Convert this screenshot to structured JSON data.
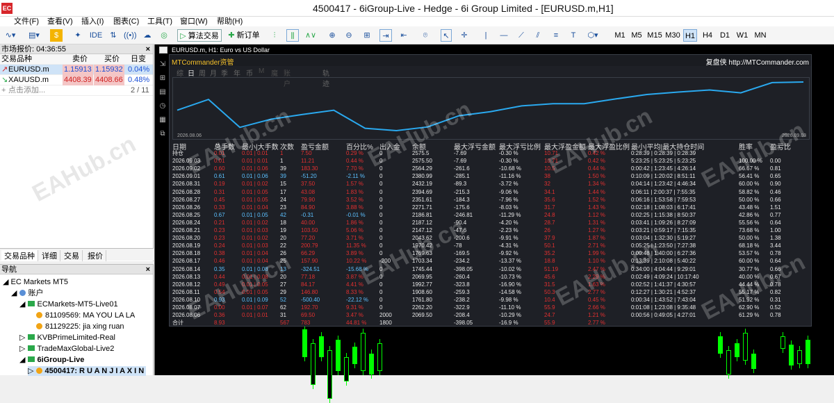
{
  "app": {
    "icon_label": "EC",
    "window_title": "4500417 - 6iGroup-Live - Hedge - 6i Group Limited - [EURUSD.m,H1]"
  },
  "menu": [
    "文件(F)",
    "查看(V)",
    "插入(I)",
    "图表(C)",
    "工具(T)",
    "窗口(W)",
    "帮助(H)"
  ],
  "toolbar": {
    "algo_trading": "算法交易",
    "new_order": "新订单",
    "ide": "IDE",
    "timeframes": [
      "M1",
      "M5",
      "M15",
      "M30",
      "H1",
      "H4",
      "D1",
      "W1",
      "MN"
    ],
    "active_tf": "H1"
  },
  "market_watch": {
    "title": "市场报价: 04:36:55",
    "columns": [
      "交易品种",
      "卖价",
      "买价",
      "日变化"
    ],
    "rows": [
      {
        "symbol": "EURUSD.m",
        "bid": "1.15913",
        "ask": "1.15932",
        "change": "0.04%"
      },
      {
        "symbol": "XAUUSD.m",
        "bid": "4408.39",
        "ask": "4408.66",
        "change": "0.48%"
      }
    ],
    "add_label": "点击添加...",
    "count": "2 / 11",
    "tabs": [
      "交易品种",
      "详细",
      "交易",
      "报价"
    ]
  },
  "navigator": {
    "title": "导航",
    "root": "EC Markets MT5",
    "accounts_label": "账户",
    "items": [
      {
        "label": "ECMarkets-MT5-Live01",
        "type": "server"
      },
      {
        "label": "81109569: MA YOU LA LA",
        "type": "account"
      },
      {
        "label": "81129225: jia xing ruan",
        "type": "account"
      },
      {
        "label": "KVBPrimeLimited-Real",
        "type": "server"
      },
      {
        "label": "TradeMaxGlobal-Live2",
        "type": "server"
      },
      {
        "label": "6iGroup-Live",
        "type": "server"
      },
      {
        "label": "4500417: R U A N J I A X I N G",
        "type": "account"
      }
    ]
  },
  "chart": {
    "title": "EURUSD.m, H1: Euro vs US Dollar",
    "watermark": "EAHub.cn",
    "colors": {
      "up": "#00ff00",
      "down": "#00ff00",
      "background": "#000000"
    }
  },
  "mtc": {
    "brand": "MTCommander资管",
    "link": "复盘侠 http://MTCommander.com",
    "period_tabs": [
      "综",
      "日",
      "周",
      "月",
      "季",
      "年",
      "币",
      "M",
      "魔",
      "账户",
      "轨迹"
    ],
    "active_tab": "日",
    "graph_start": "2026.08.06",
    "graph_end": "2026.09.03",
    "headers": [
      "日期",
      "总手数",
      "最小|大手数",
      "次数",
      "盈亏金额",
      "百分比%",
      "出入金",
      "余额",
      "最大浮亏金额",
      "最大浮亏比例",
      "最大浮盈金额",
      "最大浮盈比例",
      "最小|平均|最大持仓时间",
      "胜率",
      "盈亏比"
    ],
    "rows": [
      [
        "持仓",
        "0.01",
        "0.01 | 0.01",
        "1",
        "7.50",
        "0.29 %",
        "0",
        "2575.5",
        "-7.69",
        "-0.30 %",
        "10.71",
        "0.42 %",
        "0:28:39 | 0:28:39 | 0:28:39",
        "",
        ""
      ],
      [
        "2026.09.03",
        "0.01",
        "0.01 | 0.01",
        "1",
        "11.21",
        "0.44 %",
        "0",
        "2575.50",
        "-7.69",
        "-0.30 %",
        "10.71",
        "0.42 %",
        "5:23:25 | 5:23:25 | 5:23:25",
        "100.00 %",
        "0.00"
      ],
      [
        "2026.09.02",
        "0.60",
        "0.01 | 0.06",
        "39",
        "183.30",
        "7.70 %",
        "0",
        "2564.29",
        "-261.6",
        "-10.68 %",
        "10.5",
        "0.44 %",
        "0:00:42 | 1:23:45 | 4:26:14",
        "66.67 %",
        "0.81"
      ],
      [
        "2026.09.01",
        "0.61",
        "0.01 | 0.06",
        "39",
        "-51.20",
        "-2.11 %",
        "0",
        "2380.99",
        "-285.1",
        "-11.16 %",
        "38",
        "1.50 %",
        "0:10:09 | 1:20:02 | 8:51:11",
        "56.41 %",
        "0.65"
      ],
      [
        "2026.08.31",
        "0.19",
        "0.01 | 0.02",
        "15",
        "37.50",
        "1.57 %",
        "0",
        "2432.19",
        "-89.3",
        "-3.72 %",
        "32",
        "1.34 %",
        "0:04:14 | 1:23:42 | 4:46:34",
        "60.00 %",
        "0.90"
      ],
      [
        "2026.08.28",
        "0.31",
        "0.01 | 0.05",
        "17",
        "43.08",
        "1.83 %",
        "0",
        "2394.69",
        "-215.3",
        "-9.06 %",
        "34.1",
        "1.44 %",
        "0:06:11 | 2:00:37 | 7:55:35",
        "58.82 %",
        "0.46"
      ],
      [
        "2026.08.27",
        "0.45",
        "0.01 | 0.05",
        "24",
        "79.90",
        "3.52 %",
        "0",
        "2351.61",
        "-184.3",
        "-7.96 %",
        "35.6",
        "1.52 %",
        "0:06:16 | 1:53:58 | 7:59:53",
        "50.00 %",
        "0.66"
      ],
      [
        "2026.08.26",
        "0.33",
        "0.01 | 0.04",
        "23",
        "84.90",
        "3.88 %",
        "0",
        "2271.71",
        "-175.6",
        "-8.03 %",
        "31.7",
        "1.43 %",
        "0:02:18 | 1:08:03 | 6:17:41",
        "43.48 %",
        "1.51"
      ],
      [
        "2026.08.25",
        "0.67",
        "0.01 | 0.05",
        "42",
        "-0.31",
        "-0.01 %",
        "0",
        "2186.81",
        "-246.81",
        "-11.29 %",
        "24.8",
        "1.12 %",
        "0:02:25 | 1:15:38 | 8:50:37",
        "42.86 %",
        "0.77"
      ],
      [
        "2026.08.24",
        "0.21",
        "0.01 | 0.02",
        "18",
        "40.00",
        "1.86 %",
        "0",
        "2187.12",
        "-90.4",
        "-4.20 %",
        "28.7",
        "1.31 %",
        "0:03:41 | 1:09:26 | 8:27:09",
        "55.56 %",
        "0.64"
      ],
      [
        "2026.08.21",
        "0.23",
        "0.01 | 0.03",
        "19",
        "103.50",
        "5.06 %",
        "0",
        "2147.12",
        "-47.6",
        "-2.23 %",
        "26",
        "1.27 %",
        "0:03:21 | 0:59:17 | 7:15:35",
        "73.68 %",
        "1.00"
      ],
      [
        "2026.08.20",
        "0.23",
        "0.01 | 0.02",
        "20",
        "77.20",
        "3.71 %",
        "0",
        "2043.62",
        "-200.6",
        "-9.91 %",
        "37.9",
        "1.87 %",
        "0:03:04 | 1:32:30 | 5:19:27",
        "50.00 %",
        "1.38"
      ],
      [
        "2026.08.19",
        "0.24",
        "0.01 | 0.03",
        "22",
        "200.79",
        "11.35 %",
        "0",
        "1970.42",
        "-78",
        "-4.31 %",
        "50.1",
        "2.71 %",
        "0:05:25 | 1:23:50 | 7:27:38",
        "68.18 %",
        "3.44"
      ],
      [
        "2026.08.18",
        "0.38",
        "0.01 | 0.04",
        "26",
        "66.29",
        "3.89 %",
        "0",
        "1769.63",
        "-169.5",
        "-9.92 %",
        "35.2",
        "1.99 %",
        "0:00:48 | 1:40:00 | 6:27:36",
        "53.57 %",
        "0.78"
      ],
      [
        "2026.08.17",
        "0.46",
        "0.01 | 0.04",
        "25",
        "157.90",
        "10.22 %",
        "-200",
        "1703.34",
        "-234.2",
        "-13.37 %",
        "18.8",
        "1.10 %",
        "0:13:39 | 2:10:08 | 5:40:22",
        "60.00 %",
        "0.64"
      ],
      [
        "2026.08.14",
        "0.35",
        "0.01 | 0.08",
        "13",
        "-324.51",
        "-15.68 %",
        "0",
        "1745.44",
        "-398.05",
        "-10.02 %",
        "51.19",
        "2.47 %",
        "0:34:00 | 4:04:44 | 9:29:01",
        "30.77 %",
        "0.66"
      ],
      [
        "2026.08.13",
        "0.44",
        "0.01 | 0.08",
        "20",
        "77.18",
        "3.87 %",
        "0",
        "2069.95",
        "-260.4",
        "-10.73 %",
        "45.6",
        "2.29 %",
        "0:02:49 | 4:09:24 | 10:17:40",
        "40.00 %",
        "0.67"
      ],
      [
        "2026.08.12",
        "0.49",
        "0.01 | 0.05",
        "27",
        "84.17",
        "4.41 %",
        "0",
        "1992.77",
        "-323.8",
        "-16.90 %",
        "31.5",
        "1.63 %",
        "0:02:52 | 1:41:37 | 4:30:57",
        "44.44 %",
        "0.78"
      ],
      [
        "2026.08.11",
        "0.54",
        "0.01 | 0.05",
        "29",
        "146.80",
        "8.33 %",
        "0",
        "1908.60",
        "-259.3",
        "-14.58 %",
        "50.3",
        "2.77 %",
        "0:12:27 | 1:30:21 | 4:52:37",
        "55.17 %",
        "0.82"
      ],
      [
        "2026.08.10",
        "0.93",
        "0.01 | 0.09",
        "52",
        "-500.40",
        "-22.12 %",
        "0",
        "1761.80",
        "-238.2",
        "-9.98 %",
        "10.4",
        "0.45 %",
        "0:00:34 | 1:43:52 | 7:43:04",
        "51.92 %",
        "0.31"
      ],
      [
        "2026.08.07",
        "0.00",
        "0.01 | 0.07",
        "62",
        "192.70",
        "9.31 %",
        "0",
        "2262.20",
        "-322.9",
        "-11.10 %",
        "55.9",
        "2.66 %",
        "0:01:08 | 1:23:08 | 9:35:48",
        "62.90 %",
        "0.52"
      ],
      [
        "2026.08.06",
        "0.36",
        "0.01 | 0.01",
        "31",
        "69.50",
        "3.47 %",
        "2000",
        "2069.50",
        "-208.4",
        "-10.29 %",
        "24.7",
        "1.21 %",
        "0:00:56 | 0:49:05 | 4:27:01",
        "61.29 %",
        "0.78"
      ],
      [
        "合计",
        "8.93",
        "",
        "567",
        "783",
        "44.81 %",
        "1800",
        "",
        "-398.05",
        "-16.9 %",
        "55.9",
        "2.77 %",
        "",
        "",
        ""
      ]
    ]
  }
}
